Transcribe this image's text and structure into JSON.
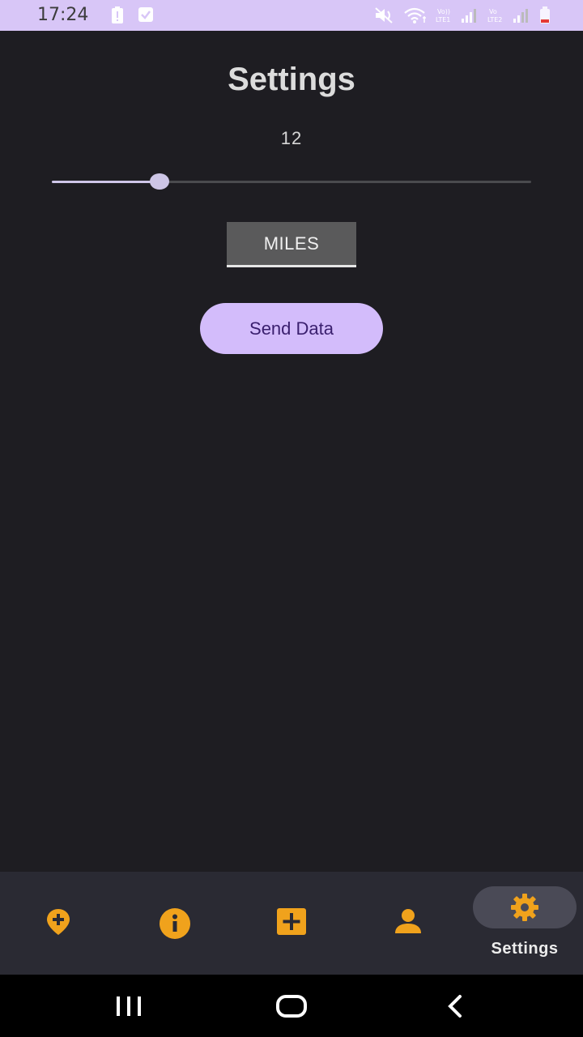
{
  "status_bar": {
    "time": "17:24",
    "icons": [
      "alert-battery-icon",
      "check-box-icon",
      "mute-icon",
      "wifi-icon",
      "volte1-signal-icon",
      "volte2-signal-icon",
      "battery-low-icon"
    ]
  },
  "page": {
    "title": "Settings"
  },
  "slider": {
    "value_label": "12",
    "fraction": 0.225
  },
  "unit_toggle": {
    "label": "MILES"
  },
  "send_button": {
    "label": "Send Data"
  },
  "bottom_nav": {
    "items": [
      {
        "icon": "add-location-icon",
        "label": ""
      },
      {
        "icon": "info-icon",
        "label": ""
      },
      {
        "icon": "add-box-icon",
        "label": ""
      },
      {
        "icon": "person-icon",
        "label": ""
      },
      {
        "icon": "gear-icon",
        "label": "Settings",
        "selected": true
      }
    ]
  },
  "colors": {
    "accent_icon": "#f0a21c",
    "primary_button": "#d3bcfb",
    "background": "#1e1d22"
  },
  "system_nav": [
    "recent-apps-icon",
    "home-icon",
    "back-icon"
  ]
}
